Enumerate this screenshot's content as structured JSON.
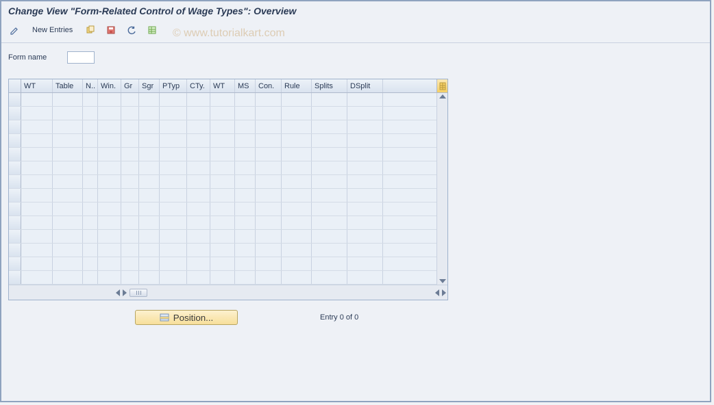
{
  "title": "Change View \"Form-Related Control of Wage Types\": Overview",
  "watermark": "© www.tutorialkart.com",
  "toolbar": {
    "new_entries_label": "New Entries"
  },
  "form": {
    "form_name_label": "Form name",
    "form_name_value": ""
  },
  "grid": {
    "columns": [
      "WT",
      "Table",
      "N..",
      "Win.",
      "Gr",
      "Sgr",
      "PTyp",
      "CTy.",
      "WT",
      "MS",
      "Con.",
      "Rule",
      "Splits",
      "DSplit"
    ],
    "rows": [
      [
        "",
        "",
        "",
        "",
        "",
        "",
        "",
        "",
        "",
        "",
        "",
        "",
        "",
        ""
      ],
      [
        "",
        "",
        "",
        "",
        "",
        "",
        "",
        "",
        "",
        "",
        "",
        "",
        "",
        ""
      ],
      [
        "",
        "",
        "",
        "",
        "",
        "",
        "",
        "",
        "",
        "",
        "",
        "",
        "",
        ""
      ],
      [
        "",
        "",
        "",
        "",
        "",
        "",
        "",
        "",
        "",
        "",
        "",
        "",
        "",
        ""
      ],
      [
        "",
        "",
        "",
        "",
        "",
        "",
        "",
        "",
        "",
        "",
        "",
        "",
        "",
        ""
      ],
      [
        "",
        "",
        "",
        "",
        "",
        "",
        "",
        "",
        "",
        "",
        "",
        "",
        "",
        ""
      ],
      [
        "",
        "",
        "",
        "",
        "",
        "",
        "",
        "",
        "",
        "",
        "",
        "",
        "",
        ""
      ],
      [
        "",
        "",
        "",
        "",
        "",
        "",
        "",
        "",
        "",
        "",
        "",
        "",
        "",
        ""
      ],
      [
        "",
        "",
        "",
        "",
        "",
        "",
        "",
        "",
        "",
        "",
        "",
        "",
        "",
        ""
      ],
      [
        "",
        "",
        "",
        "",
        "",
        "",
        "",
        "",
        "",
        "",
        "",
        "",
        "",
        ""
      ],
      [
        "",
        "",
        "",
        "",
        "",
        "",
        "",
        "",
        "",
        "",
        "",
        "",
        "",
        ""
      ],
      [
        "",
        "",
        "",
        "",
        "",
        "",
        "",
        "",
        "",
        "",
        "",
        "",
        "",
        ""
      ],
      [
        "",
        "",
        "",
        "",
        "",
        "",
        "",
        "",
        "",
        "",
        "",
        "",
        "",
        ""
      ],
      [
        "",
        "",
        "",
        "",
        "",
        "",
        "",
        "",
        "",
        "",
        "",
        "",
        "",
        ""
      ]
    ]
  },
  "footer": {
    "position_label": "Position...",
    "status": "Entry 0 of 0"
  }
}
